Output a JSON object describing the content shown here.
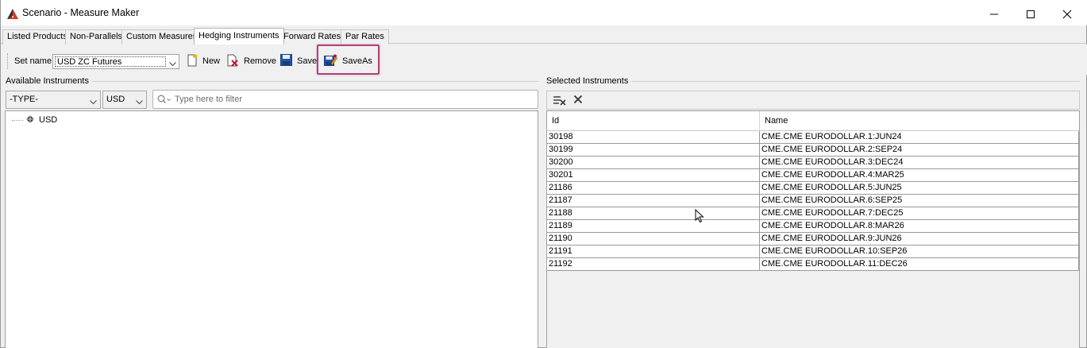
{
  "window": {
    "title": "Scenario - Measure Maker"
  },
  "tabs": [
    {
      "label": "Listed Products",
      "active": false
    },
    {
      "label": "Non-Parallels",
      "active": false
    },
    {
      "label": "Custom Measures",
      "active": false
    },
    {
      "label": "Hedging Instruments",
      "active": true
    },
    {
      "label": "Forward Rates",
      "active": false
    },
    {
      "label": "Par Rates",
      "active": false
    }
  ],
  "toolbar": {
    "set_name_label": "Set name:",
    "set_name_value": "USD ZC Futures",
    "new_label": "New",
    "remove_label": "Remove",
    "save_label": "Save",
    "saveas_label": "SaveAs"
  },
  "available": {
    "group_label": "Available Instruments",
    "type_value": "-TYPE-",
    "currency_value": "USD",
    "filter_placeholder": "Type here to filter",
    "tree_root": "USD"
  },
  "selected": {
    "group_label": "Selected Instruments",
    "columns": [
      "Id",
      "Name"
    ],
    "rows": [
      {
        "id": "30198",
        "name": "CME.CME EURODOLLAR.1:JUN24"
      },
      {
        "id": "30199",
        "name": "CME.CME EURODOLLAR.2:SEP24"
      },
      {
        "id": "30200",
        "name": "CME.CME EURODOLLAR.3:DEC24"
      },
      {
        "id": "30201",
        "name": "CME.CME EURODOLLAR.4:MAR25"
      },
      {
        "id": "21186",
        "name": "CME.CME EURODOLLAR.5:JUN25"
      },
      {
        "id": "21187",
        "name": "CME.CME EURODOLLAR.6:SEP25"
      },
      {
        "id": "21188",
        "name": "CME.CME EURODOLLAR.7:DEC25"
      },
      {
        "id": "21189",
        "name": "CME.CME EURODOLLAR.8:MAR26"
      },
      {
        "id": "21190",
        "name": "CME.CME EURODOLLAR.9:JUN26"
      },
      {
        "id": "21191",
        "name": "CME.CME EURODOLLAR.10:SEP26"
      },
      {
        "id": "21192",
        "name": "CME.CME EURODOLLAR.11:DEC26"
      }
    ]
  },
  "icons": {
    "app": "app-logo-icon",
    "minimize": "minimize-icon",
    "maximize": "maximize-icon",
    "close": "close-icon",
    "new": "new-document-icon",
    "remove": "remove-document-icon",
    "save": "floppy-disk-icon",
    "saveas": "save-as-icon",
    "search": "search-icon",
    "clear_all": "clear-list-icon",
    "delete": "delete-x-icon"
  },
  "colors": {
    "highlight": "#b0407a",
    "app_logo_red": "#d9381e",
    "app_logo_dark": "#333333"
  }
}
